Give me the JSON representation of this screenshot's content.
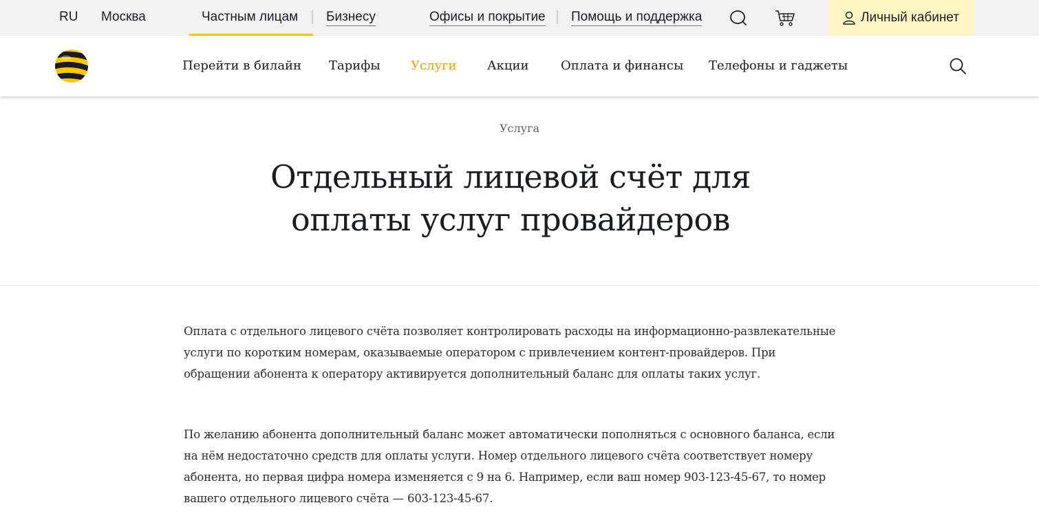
{
  "topbar": {
    "lang": "RU",
    "city": "Москва",
    "segments": [
      {
        "label": "Частным лицам",
        "active": true
      },
      {
        "label": "Бизнесу",
        "active": false
      }
    ],
    "links": [
      {
        "label": "Офисы и покрытие"
      },
      {
        "label": "Помощь и поддержка"
      }
    ],
    "icons": {
      "search": "search-icon",
      "cart": "cart-icon",
      "user": "user-icon"
    },
    "cabinet_label": "Личный кабинет"
  },
  "nav": {
    "items": [
      {
        "label": "Перейти в билайн",
        "active": false
      },
      {
        "label": "Тарифы",
        "active": false
      },
      {
        "label": "Услуги",
        "active": true
      },
      {
        "label": "Акции",
        "active": false
      },
      {
        "label": "Оплата и финансы",
        "active": false
      },
      {
        "label": "Телефоны и гаджеты",
        "active": false
      }
    ]
  },
  "hero": {
    "eyebrow": "Услуга",
    "title_line1": "Отдельный лицевой счёт для",
    "title_line2": "оплаты услуг провайдеров"
  },
  "content": {
    "p1": "Оплата с отдельного лицевого счёта позволяет контролировать расходы на информационно-развлекательные услуги по коротким номерам, оказываемые оператором с привлечением контент-провайдеров. При обращении абонента к оператору активируется дополнительный баланс для оплаты таких услуг.",
    "p2": "По желанию абонента дополнительный баланс может автоматически пополняться с основного баланса, если на нём недостаточно средств для оплаты услуги. Номер отдельного лицевого счёта соответствует номеру абонента, но первая цифра номера изменяется с 9 на 6. Например, если ваш номер 903-123-45-67, то номер вашего отдельного лицевого счёта — 603-123-45-67."
  },
  "colors": {
    "accent": "#fcc800",
    "accent_text": "#e8a500",
    "topbar_bg": "#f2f2f2",
    "cabinet_bg": "#fff6c4",
    "text": "#191c21"
  }
}
